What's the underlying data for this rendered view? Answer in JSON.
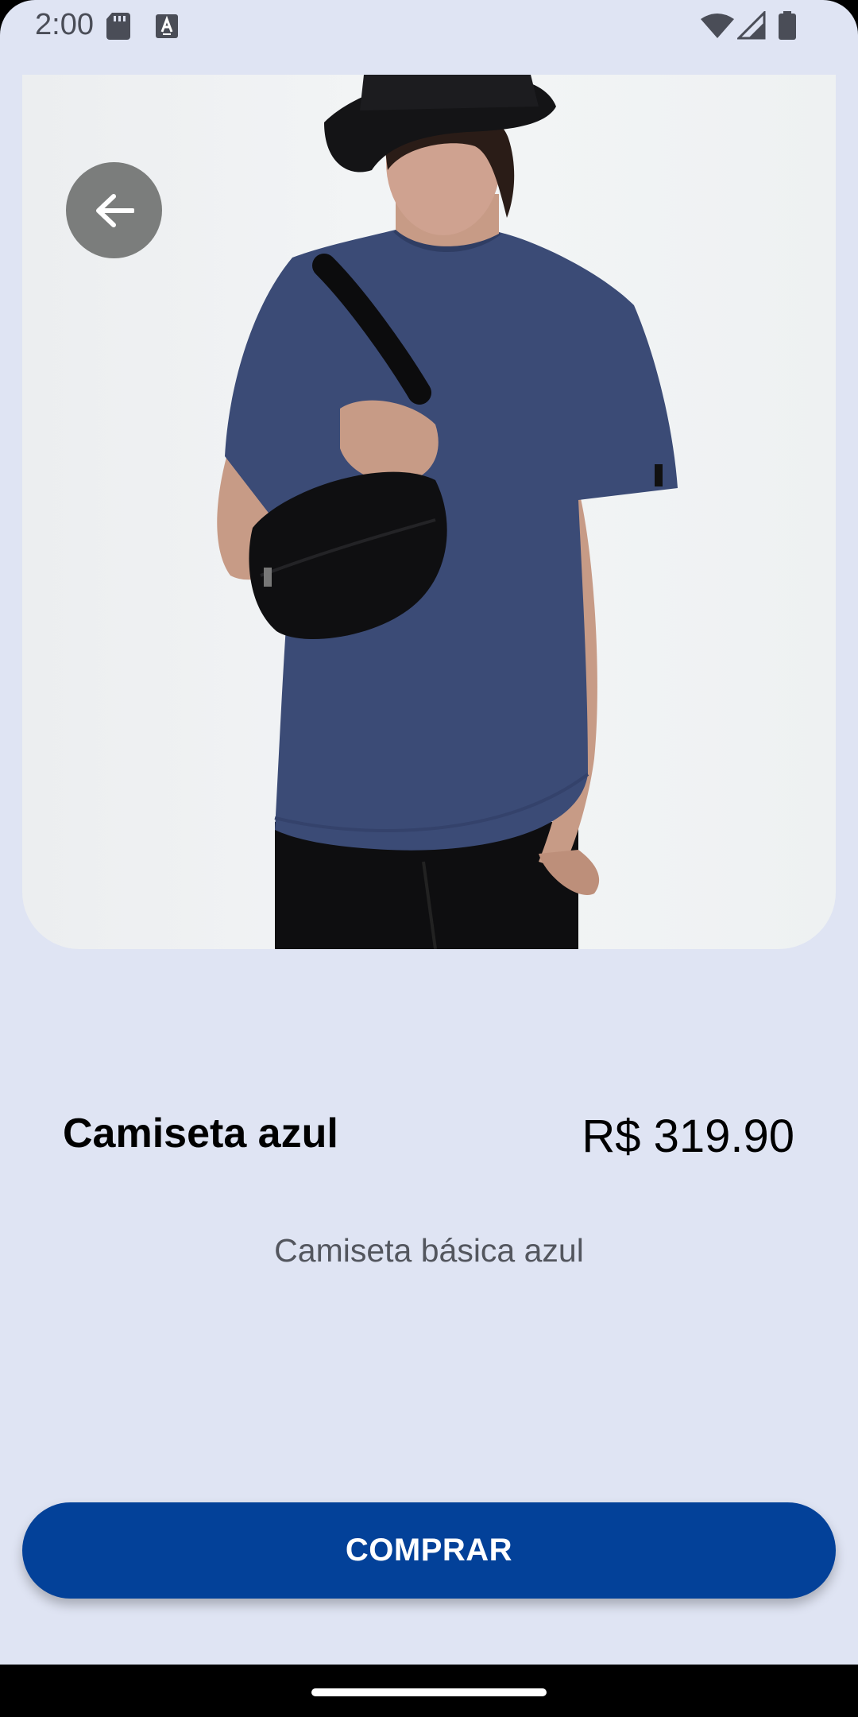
{
  "status_bar": {
    "time": "2:00",
    "icons": [
      "sd-card-icon",
      "a-notification-icon",
      "wifi-icon",
      "signal-icon",
      "battery-icon"
    ]
  },
  "product": {
    "name": "Camiseta azul",
    "price": "R$ 319.90",
    "description": "Camiseta básica azul",
    "image_alt": "product-photo"
  },
  "actions": {
    "back_icon": "arrow-left-icon",
    "buy_label": "COMPRAR"
  },
  "colors": {
    "background": "#dfe4f3",
    "buy_button": "#034199",
    "back_button": "#7b7d7c",
    "shirt": "#3b4b76"
  }
}
